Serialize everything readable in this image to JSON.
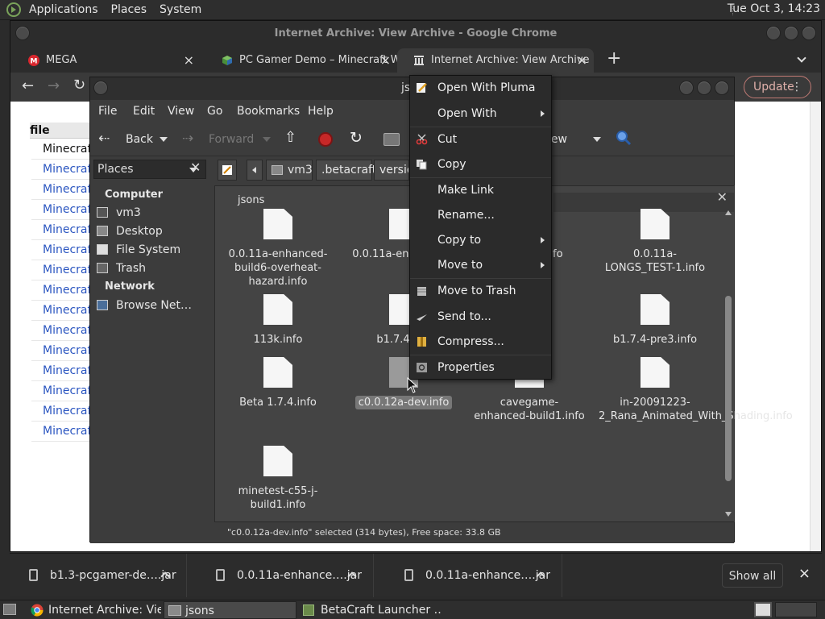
{
  "top_panel": {
    "menus": [
      "Applications",
      "Places",
      "System"
    ],
    "clock": "Tue Oct  3, 14:23"
  },
  "chrome": {
    "title": "Internet Archive: View Archive - Google Chrome",
    "tabs": [
      {
        "label": "MEGA",
        "icon": "mega-icon",
        "close": "×"
      },
      {
        "label": "PC Gamer Demo – Minecraft W",
        "icon": "cube-icon",
        "close": "×"
      },
      {
        "label": "Internet Archive: View Archive",
        "icon": "archive-icon",
        "close": "×"
      }
    ],
    "new_tab": "+",
    "update_label": "Update",
    "page": {
      "column_header": "file",
      "items": [
        "Minecraft",
        "Minecraft",
        "Minecraft",
        "Minecraft",
        "Minecraft",
        "Minecraft",
        "Minecraft",
        "Minecraft",
        "Minecraft",
        "Minecraft",
        "Minecraft",
        "Minecraft",
        "Minecraft",
        "Minecraft",
        "Minecraft"
      ]
    }
  },
  "file_manager": {
    "title_partial": "js",
    "menu": [
      "File",
      "Edit",
      "View",
      "Go",
      "Bookmarks",
      "Help"
    ],
    "toolbar": {
      "back": "Back",
      "forward": "Forward",
      "view_partial": "iew"
    },
    "places_label": "Places",
    "breadcrumbs": [
      "vm3",
      ".betacraft",
      "version"
    ],
    "sidebar": {
      "computer_header": "Computer",
      "computer_items": [
        {
          "label": "vm3",
          "icon": "home-folder-icon"
        },
        {
          "label": "Desktop",
          "icon": "desktop-icon"
        },
        {
          "label": "File System",
          "icon": "drive-icon"
        },
        {
          "label": "Trash",
          "icon": "trash-icon"
        }
      ],
      "network_header": "Network",
      "network_items": [
        {
          "label": "Browse Net…",
          "icon": "network-icon"
        }
      ]
    },
    "pane_tab": "jsons",
    "files": [
      {
        "name": "0.0.11a-enhanced-build6-overheat-hazard.info"
      },
      {
        "name": "0.0.11a-en… build7"
      },
      {
        "name": "…nced-…nfo"
      },
      {
        "name": "0.0.11a-LONGS_TEST-1.info"
      },
      {
        "name": "113k.info"
      },
      {
        "name": "b1.7.4-p…"
      },
      {
        "name": "…info"
      },
      {
        "name": "b1.7.4-pre3.info"
      },
      {
        "name": "Beta 1.7.4.info"
      },
      {
        "name": "c0.0.12a-dev.info"
      },
      {
        "name": "cavegame-enhanced-build1.info"
      },
      {
        "name": "in-20091223-2_Rana_Animated_With_Shading.info"
      },
      {
        "name": "minetest-c55-j-build1.info"
      }
    ],
    "status": "\"c0.0.12a-dev.info\" selected (314 bytes), Free space: 33.8 GB"
  },
  "context_menu": {
    "items": [
      {
        "label": "Open With Pluma",
        "icon": "pluma-icon"
      },
      {
        "label": "Open With",
        "submenu": true
      },
      {
        "label": "Cut",
        "icon": "scissors-icon"
      },
      {
        "label": "Copy",
        "icon": "copy-icon"
      },
      {
        "label": "Make Link"
      },
      {
        "label": "Rename..."
      },
      {
        "label": "Copy to",
        "submenu": true
      },
      {
        "label": "Move to",
        "submenu": true
      },
      {
        "label": "Move to Trash",
        "icon": "trash-icon"
      },
      {
        "label": "Send to...",
        "icon": "send-icon"
      },
      {
        "label": "Compress...",
        "icon": "archive-icon"
      },
      {
        "label": "Properties",
        "icon": "properties-icon"
      }
    ]
  },
  "downloads": {
    "items": [
      "b1.3-pcgamer-de….jar",
      "0.0.11a-enhance….jar",
      "0.0.11a-enhance….jar"
    ],
    "show_all": "Show all",
    "close": "×"
  },
  "taskbar": {
    "tasks": [
      "Internet Archive: Vie…",
      "jsons",
      "BetaCraft Launcher …"
    ]
  },
  "colors": {
    "accent_link": "#2a55c0",
    "dark_bg": "#2b2b2b",
    "update_border": "#c07a74"
  }
}
